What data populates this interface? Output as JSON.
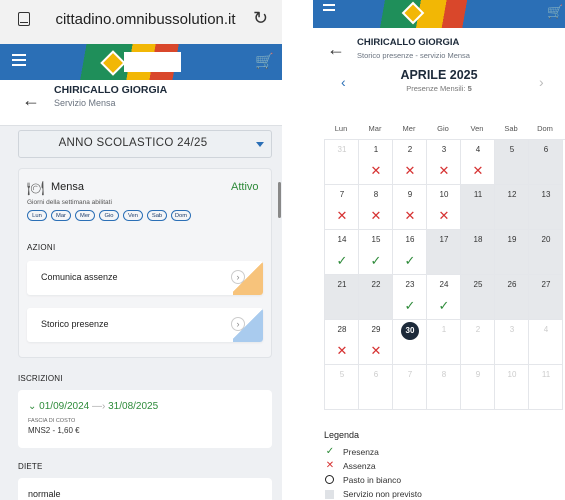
{
  "left": {
    "browser": {
      "url": "cittadino.omnibussolution.it"
    },
    "header": {
      "name": "CHIRICALLO GIORGIA",
      "subtitle": "Servizio Mensa"
    },
    "year_select": {
      "value": "ANNO SCOLASTICO 24/25"
    },
    "mensa": {
      "title": "Mensa",
      "status": "Attivo",
      "days_label": "Giorni della settimana abilitati",
      "days": [
        "Lun",
        "Mar",
        "Mer",
        "Gio",
        "Ven",
        "Sab",
        "Dom"
      ],
      "actions_title": "AZIONI",
      "actions": [
        "Comunica assenze",
        "Storico presenze"
      ]
    },
    "iscrizioni": {
      "title": "ISCRIZIONI",
      "date_from": "01/09/2024",
      "date_to": "31/08/2025",
      "fascia_label": "FASCIA DI COSTO",
      "fascia_value": "MNS2 - 1,60 €"
    },
    "diete": {
      "title": "DIETE",
      "value": "normale"
    }
  },
  "right": {
    "header": {
      "name": "CHIRICALLO GIORGIA",
      "subtitle": "Storico presenze - servizio Mensa"
    },
    "month": {
      "title": "APRILE 2025",
      "presenze_label": "Presenze Mensili:",
      "presenze_value": "5"
    },
    "weekdays": [
      "Lun",
      "Mar",
      "Mer",
      "Gio",
      "Ven",
      "Sab",
      "Dom"
    ],
    "days": [
      {
        "n": "31",
        "faded": true,
        "ns": false,
        "mark": ""
      },
      {
        "n": "1",
        "ns": false,
        "mark": "assenza"
      },
      {
        "n": "2",
        "ns": false,
        "mark": "assenza"
      },
      {
        "n": "3",
        "ns": false,
        "mark": "assenza"
      },
      {
        "n": "4",
        "ns": false,
        "mark": "assenza"
      },
      {
        "n": "5",
        "ns": true,
        "mark": ""
      },
      {
        "n": "6",
        "ns": true,
        "mark": ""
      },
      {
        "n": "7",
        "ns": false,
        "mark": "assenza"
      },
      {
        "n": "8",
        "ns": false,
        "mark": "assenza"
      },
      {
        "n": "9",
        "ns": false,
        "mark": "assenza"
      },
      {
        "n": "10",
        "ns": false,
        "mark": "assenza"
      },
      {
        "n": "11",
        "ns": true,
        "mark": ""
      },
      {
        "n": "12",
        "ns": true,
        "mark": ""
      },
      {
        "n": "13",
        "ns": true,
        "mark": ""
      },
      {
        "n": "14",
        "ns": false,
        "mark": "presenza"
      },
      {
        "n": "15",
        "ns": false,
        "mark": "presenza"
      },
      {
        "n": "16",
        "ns": false,
        "mark": "presenza"
      },
      {
        "n": "17",
        "ns": true,
        "mark": ""
      },
      {
        "n": "18",
        "ns": true,
        "mark": ""
      },
      {
        "n": "19",
        "ns": true,
        "mark": ""
      },
      {
        "n": "20",
        "ns": true,
        "mark": ""
      },
      {
        "n": "21",
        "ns": true,
        "mark": ""
      },
      {
        "n": "22",
        "ns": true,
        "mark": ""
      },
      {
        "n": "23",
        "ns": false,
        "mark": "presenza"
      },
      {
        "n": "24",
        "ns": false,
        "mark": "presenza"
      },
      {
        "n": "25",
        "ns": true,
        "mark": ""
      },
      {
        "n": "26",
        "ns": true,
        "mark": ""
      },
      {
        "n": "27",
        "ns": true,
        "mark": ""
      },
      {
        "n": "28",
        "ns": false,
        "mark": "assenza"
      },
      {
        "n": "29",
        "ns": false,
        "mark": "assenza"
      },
      {
        "n": "30",
        "ns": false,
        "mark": "",
        "today": true
      },
      {
        "n": "1",
        "faded": true,
        "ns": false,
        "mark": ""
      },
      {
        "n": "2",
        "faded": true,
        "ns": false,
        "mark": ""
      },
      {
        "n": "3",
        "faded": true,
        "ns": false,
        "mark": ""
      },
      {
        "n": "4",
        "faded": true,
        "ns": false,
        "mark": ""
      },
      {
        "n": "5",
        "faded": true,
        "ns": false,
        "mark": ""
      },
      {
        "n": "6",
        "faded": true,
        "ns": false,
        "mark": ""
      },
      {
        "n": "7",
        "faded": true,
        "ns": false,
        "mark": ""
      },
      {
        "n": "8",
        "faded": true,
        "ns": false,
        "mark": ""
      },
      {
        "n": "9",
        "faded": true,
        "ns": false,
        "mark": ""
      },
      {
        "n": "10",
        "faded": true,
        "ns": false,
        "mark": ""
      },
      {
        "n": "11",
        "faded": true,
        "ns": false,
        "mark": ""
      }
    ],
    "legend": {
      "title": "Legenda",
      "items": [
        {
          "icon": "check-icon",
          "label": "Presenza"
        },
        {
          "icon": "cross-icon",
          "label": "Assenza"
        },
        {
          "icon": "circle-icon",
          "label": "Pasto in bianco"
        },
        {
          "icon": "square-icon",
          "label": "Servizio non previsto"
        }
      ]
    },
    "colors": {
      "presenza": "#2e8b3a",
      "assenza": "#d63232",
      "accent": "#2b6fb6"
    }
  }
}
